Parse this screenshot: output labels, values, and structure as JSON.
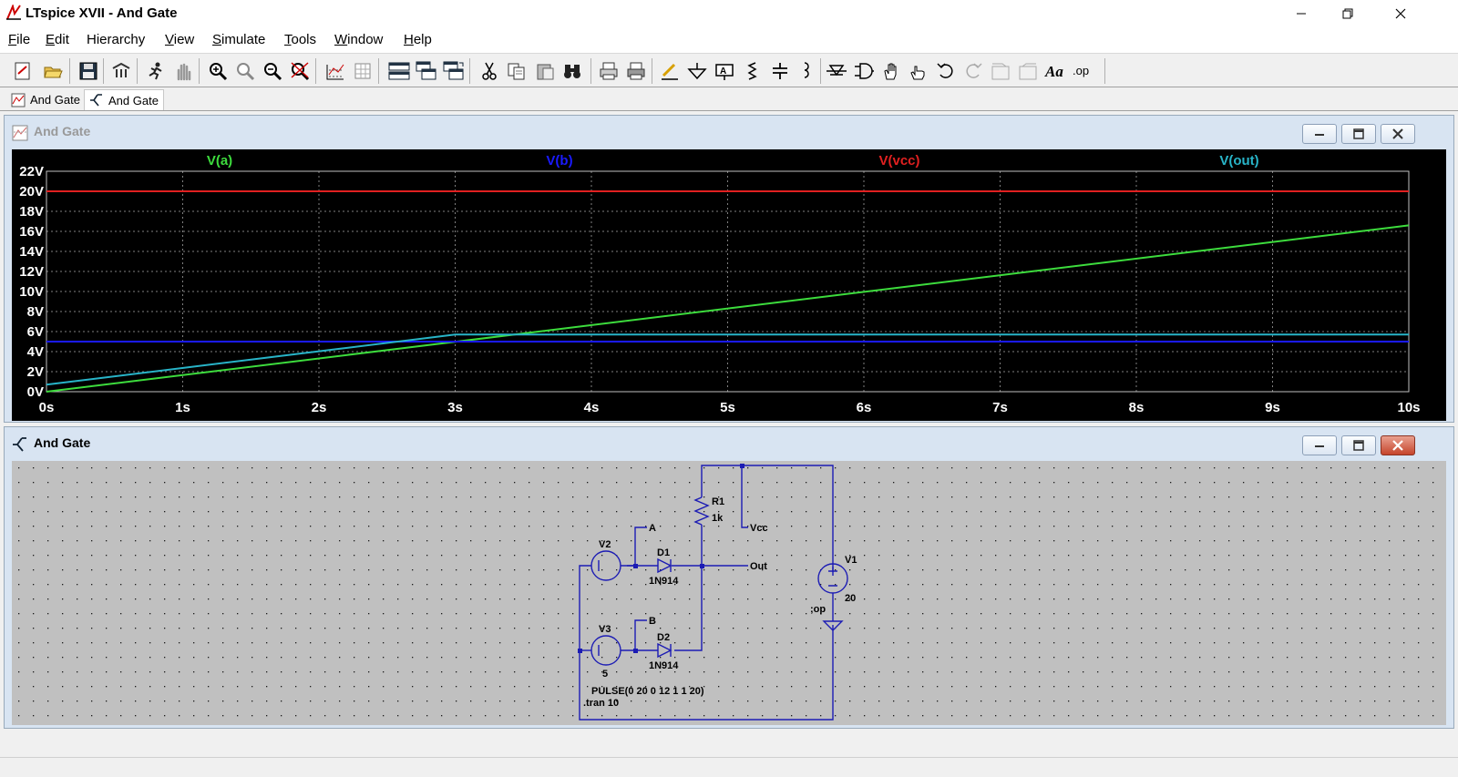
{
  "window": {
    "title": "LTspice XVII - And Gate"
  },
  "menu": [
    {
      "label": "File",
      "u": "F",
      "rest": "ile"
    },
    {
      "label": "Edit",
      "u": "E",
      "rest": "dit"
    },
    {
      "label": "Hierarchy",
      "u": "Hi",
      "rest": "erarchy"
    },
    {
      "label": "View",
      "u": "V",
      "rest": "iew"
    },
    {
      "label": "Simulate",
      "u": "S",
      "rest": "imulate"
    },
    {
      "label": "Tools",
      "u": "T",
      "rest": "ools"
    },
    {
      "label": "Window",
      "u": "W",
      "rest": "indow"
    },
    {
      "label": "Help",
      "u": "H",
      "rest": "elp"
    }
  ],
  "tabs": [
    {
      "label": "And Gate",
      "icon": "waveform-icon"
    },
    {
      "label": "And Gate",
      "icon": "schematic-icon"
    }
  ],
  "plot_window": {
    "title": "And Gate"
  },
  "schematic_window": {
    "title": "And Gate"
  },
  "chart_data": {
    "type": "line",
    "xlim": [
      0,
      10
    ],
    "ylim": [
      0,
      22
    ],
    "x_ticks": [
      "0s",
      "1s",
      "2s",
      "3s",
      "4s",
      "5s",
      "6s",
      "7s",
      "8s",
      "9s",
      "10s"
    ],
    "y_ticks": [
      "0V",
      "2V",
      "4V",
      "6V",
      "8V",
      "10V",
      "12V",
      "14V",
      "16V",
      "18V",
      "20V",
      "22V"
    ],
    "grid": true,
    "series": [
      {
        "name": "V(a)",
        "color": "#3ddc3d",
        "x": [
          0,
          10
        ],
        "y": [
          0,
          16.6
        ]
      },
      {
        "name": "V(b)",
        "color": "#1a1aff",
        "x": [
          0,
          10
        ],
        "y": [
          5,
          5
        ]
      },
      {
        "name": "V(vcc)",
        "color": "#e02020",
        "x": [
          0,
          10
        ],
        "y": [
          20,
          20
        ]
      },
      {
        "name": "V(out)",
        "color": "#28b4c8",
        "x": [
          0,
          3,
          10
        ],
        "y": [
          0.7,
          5.7,
          5.7
        ]
      }
    ]
  },
  "schematic": {
    "labels": {
      "r1_name": "R1",
      "r1_val": "1k",
      "vcc": "Vcc",
      "out": "Out",
      "v1_name": "V1",
      "v1_val": "20",
      "op": ";op",
      "v2_name": "V2",
      "a": "A",
      "d1_name": "D1",
      "d1_model": "1N914",
      "v3_name": "V3",
      "v3_val": "5",
      "b": "B",
      "d2_name": "D2",
      "d2_model": "1N914",
      "pulse": "PULSE(0 20 0 12 1 1 20)",
      "tran": ".tran 10"
    }
  },
  "toolbar": [
    "new-schematic-icon",
    "open-icon",
    "save-icon",
    "control-panel-icon",
    "run-icon",
    "halt-icon",
    "zoom-in-icon",
    "zoom-fit-icon",
    "zoom-out-icon",
    "zoom-cancel-icon",
    "autorange-icon",
    "grid-icon",
    "tile-horizontal-icon",
    "cascade-icon",
    "tile-vertical-icon",
    "cut-icon",
    "copy-icon",
    "paste-icon",
    "find-icon",
    "print-setup-icon",
    "print-icon",
    "wire-icon",
    "ground-icon",
    "label-net-icon",
    "resistor-icon",
    "capacitor-icon",
    "inductor-icon",
    "diode-icon",
    "component-icon",
    "move-icon",
    "drag-icon",
    "undo-icon",
    "redo-icon",
    "rotate-icon",
    "mirror-icon",
    "text-icon",
    "spice-directive-icon"
  ]
}
